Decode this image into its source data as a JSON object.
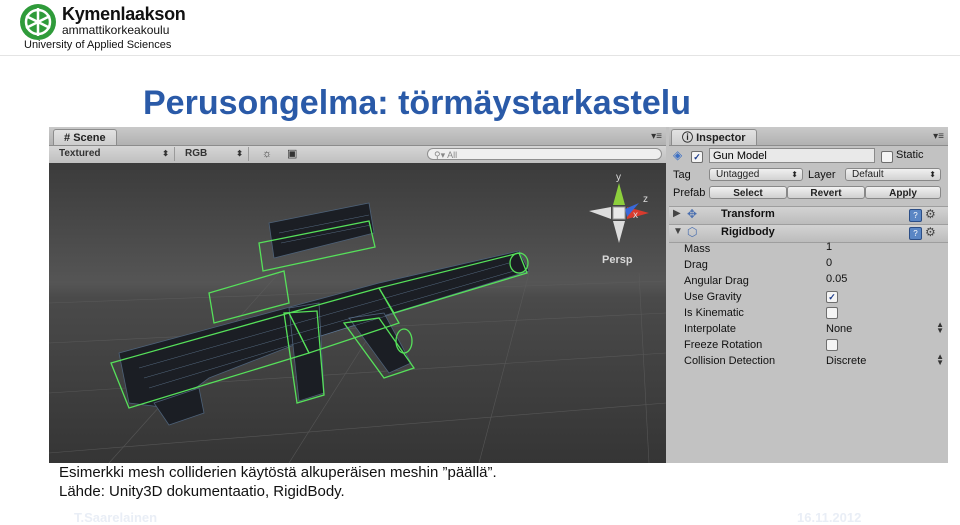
{
  "header": {
    "org_name": "Kymenlaakson",
    "org_sub": "ammattikorkeakoulu",
    "org_english": "University of Applied Sciences"
  },
  "slide": {
    "title": "Perusongelma: törmäystarkastelu"
  },
  "scene_panel": {
    "tab_label": "Scene",
    "render_mode": "Textured",
    "color_mode": "RGB",
    "search_placeholder": "All",
    "view_label": "Persp",
    "gizmo_axes": {
      "y": "y",
      "x": "x",
      "z": "z"
    }
  },
  "inspector": {
    "tab_label": "Inspector",
    "object_name": "Gun Model",
    "static_label": "Static",
    "static_checked": false,
    "tag_label": "Tag",
    "tag_value": "Untagged",
    "layer_label": "Layer",
    "layer_value": "Default",
    "prefab_label": "Prefab",
    "select_button": "Select",
    "revert_button": "Revert",
    "apply_button": "Apply",
    "transform_title": "Transform",
    "rigidbody_title": "Rigidbody",
    "properties": [
      {
        "label": "Mass",
        "value": "1"
      },
      {
        "label": "Drag",
        "value": "0"
      },
      {
        "label": "Angular Drag",
        "value": "0.05"
      },
      {
        "label": "Use Gravity",
        "checked": true
      },
      {
        "label": "Is Kinematic",
        "checked": false
      },
      {
        "label": "Interpolate",
        "value": "None"
      },
      {
        "label": "Freeze Rotation",
        "checked": false
      },
      {
        "label": "Collision Detection",
        "value": "Discrete"
      }
    ]
  },
  "captions": {
    "line1": "Esimerkki mesh colliderien käytöstä alkuperäisen meshin ”päällä”.",
    "line2": "Lähde: Unity3D dokumentaatio, RigidBody."
  },
  "footer": {
    "author": "T.Saarelainen",
    "date": "16.11.2012"
  },
  "colors": {
    "title": "#2a5aa8",
    "logo_green": "#2f9b3a",
    "collider_green": "#56e05a",
    "footer_text": "#e9eef6"
  }
}
